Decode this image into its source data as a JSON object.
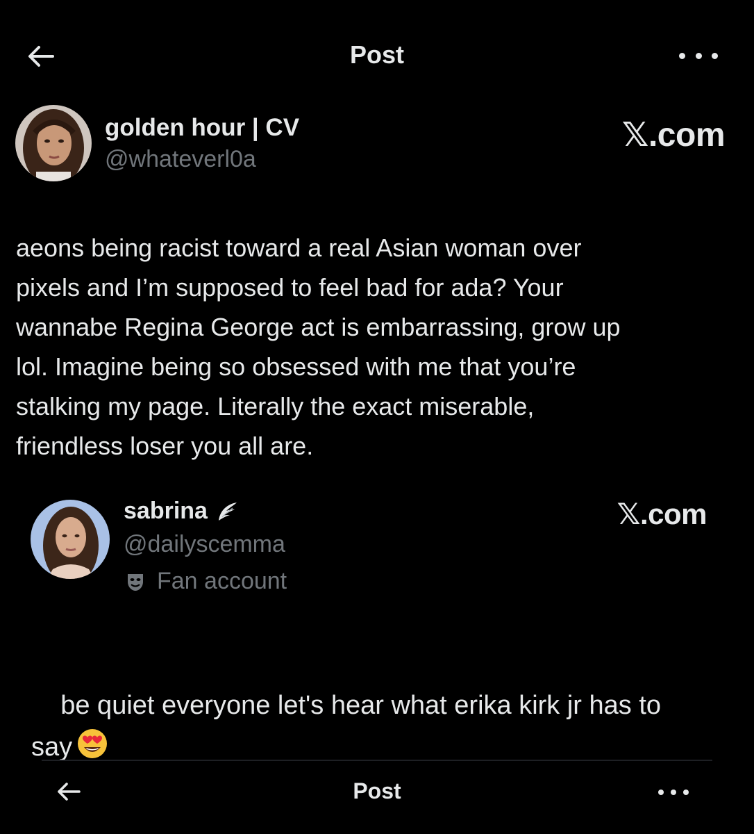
{
  "header": {
    "title": "Post",
    "back_icon": "arrow-left-icon",
    "more_icon": "more-horizontal-icon"
  },
  "post": {
    "display_name": "golden hour | CV",
    "handle": "@whateverl0a",
    "watermark": "𝕏.com",
    "text": "aeons being racist toward a real Asian woman over\npixels and I’m supposed to feel bad for ada? Your\nwannabe Regina George act is embarrassing, grow up\nlol. Imagine being so obsessed with me that you’re\nstalking my page. Literally the exact miserable,\nfriendless loser you all are."
  },
  "quoted_post": {
    "display_name": "sabrina",
    "name_badge_icon": "angel-wing-icon",
    "handle": "@dailyscemma",
    "label_icon": "theater-masks-icon",
    "label": "Fan account",
    "watermark": "𝕏.com",
    "text_line1": "be quiet everyone let's hear what erika kirk jr has to",
    "text_line2": "say",
    "emoji": "heart-eyes-emoji"
  },
  "footer_bar": {
    "title": "Post",
    "back_icon": "arrow-left-icon",
    "more_icon": "more-horizontal-icon"
  },
  "colors": {
    "background": "#000000",
    "primary_text": "#e7e9ea",
    "secondary_text": "#71767b"
  }
}
